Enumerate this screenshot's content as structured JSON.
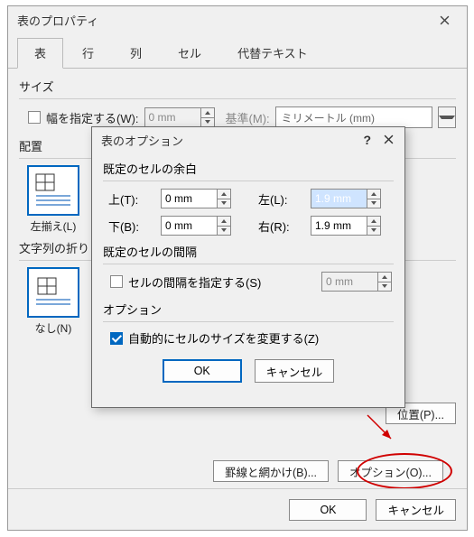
{
  "parent": {
    "title": "表のプロパティ",
    "tabs": [
      "表",
      "行",
      "列",
      "セル",
      "代替テキスト"
    ],
    "size_label": "サイズ",
    "width_chk": "幅を指定する(W):",
    "width_val": "0 mm",
    "unit_label": "基準(M):",
    "unit_val": "ミリメートル (mm)",
    "align_label": "配置",
    "align_left": "左揃え(L)",
    "wrap_label": "文字列の折り",
    "wrap_none": "なし(N)",
    "position_btn": "位置(P)...",
    "borders_btn": "罫線と網かけ(B)...",
    "options_btn": "オプション(O)...",
    "ok": "OK",
    "cancel": "キャンセル"
  },
  "child": {
    "title": "表のオプション",
    "margins_label": "既定のセルの余白",
    "top_l": "上(T):",
    "top_v": "0 mm",
    "bottom_l": "下(B):",
    "bottom_v": "0 mm",
    "left_l": "左(L):",
    "left_v": "1.9 mm",
    "right_l": "右(R):",
    "right_v": "1.9 mm",
    "spacing_label": "既定のセルの間隔",
    "spacing_chk": "セルの間隔を指定する(S)",
    "spacing_val": "0 mm",
    "options_label": "オプション",
    "autosize_chk": "自動的にセルのサイズを変更する(Z)",
    "ok": "OK",
    "cancel": "キャンセル"
  }
}
